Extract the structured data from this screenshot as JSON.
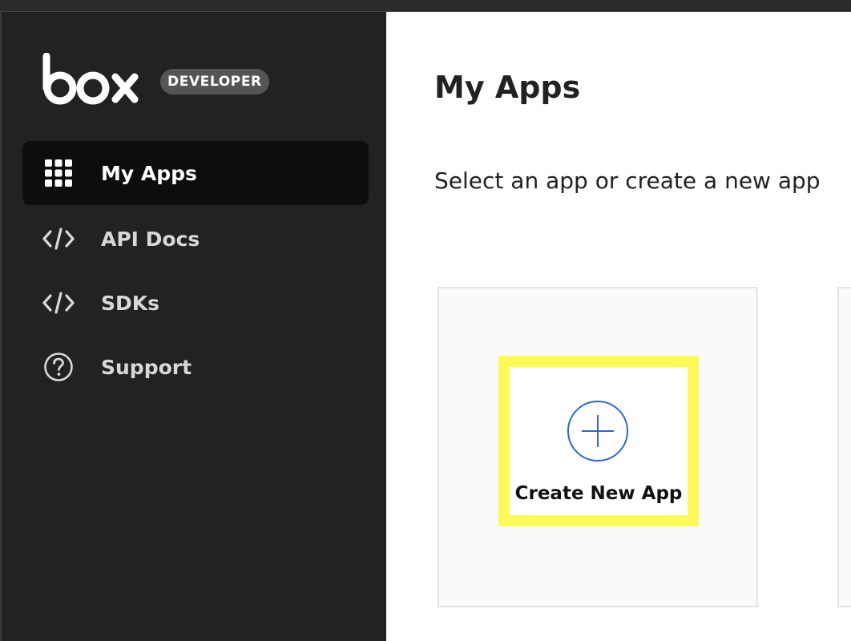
{
  "brand": {
    "logo_text": "box",
    "badge": "DEVELOPER"
  },
  "sidebar": {
    "items": [
      {
        "label": "My Apps",
        "icon": "grid-icon",
        "active": true
      },
      {
        "label": "API Docs",
        "icon": "code-icon",
        "active": false
      },
      {
        "label": "SDKs",
        "icon": "code-icon",
        "active": false
      },
      {
        "label": "Support",
        "icon": "help-circle-icon",
        "active": false
      }
    ]
  },
  "main": {
    "title": "My Apps",
    "subtitle": "Select an app or create a new app",
    "create_card": {
      "label": "Create New App",
      "icon": "plus-circle-icon"
    }
  },
  "colors": {
    "sidebar_bg": "#222222",
    "active_item_bg": "#0d0d0d",
    "accent_blue": "#2f66c9",
    "highlight": "#fdf95a"
  }
}
